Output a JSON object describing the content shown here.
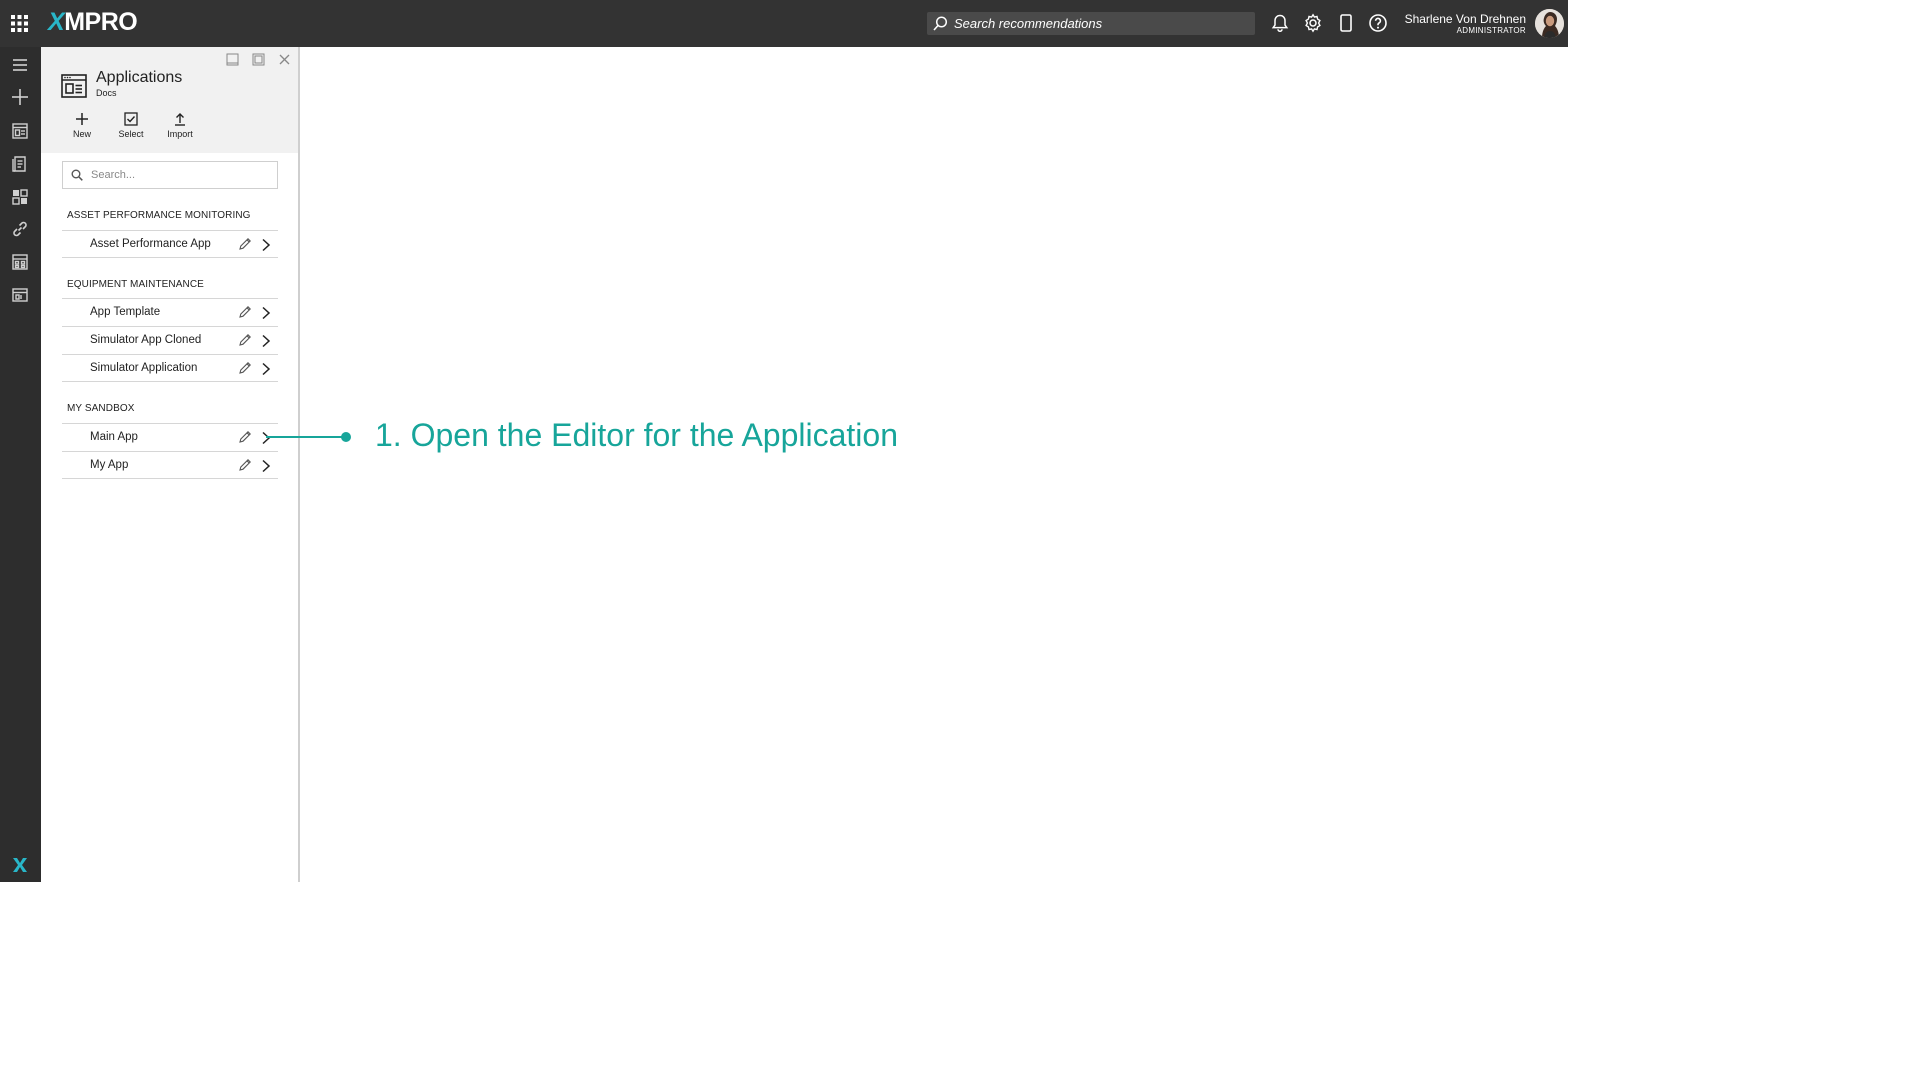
{
  "header": {
    "logo": "XMPRO",
    "search_placeholder": "Search recommendations",
    "user_name": "Sharlene Von Drehnen",
    "user_role": "ADMINISTRATOR"
  },
  "rail": {
    "icons": [
      "menu-icon",
      "add-icon",
      "applications-icon",
      "recommendations-icon",
      "dashboard-icon",
      "link-icon",
      "calculator-icon",
      "layout-icon"
    ],
    "bottom_logo_icon": "xmpro-x-icon"
  },
  "panel": {
    "title": "Applications",
    "subtitle": "Docs",
    "tools": [
      {
        "label": "New",
        "icon": "plus-icon"
      },
      {
        "label": "Select",
        "icon": "checkbox-icon"
      },
      {
        "label": "Import",
        "icon": "upload-icon"
      }
    ],
    "search_placeholder": "Search...",
    "groups": [
      {
        "title": "ASSET PERFORMANCE MONITORING",
        "items": [
          "Asset Performance App"
        ]
      },
      {
        "title": "EQUIPMENT MAINTENANCE",
        "items": [
          "App Template",
          "Simulator App Cloned",
          "Simulator Application"
        ]
      },
      {
        "title": "MY SANDBOX",
        "items": [
          "Main App",
          "My App"
        ]
      }
    ]
  },
  "annotation": {
    "text": "1. Open the Editor for the Application",
    "color": "#17a59a"
  },
  "colors": {
    "topbar": "#333333",
    "rail": "#2d2d2d",
    "logo_accent": "#29b6c8"
  }
}
